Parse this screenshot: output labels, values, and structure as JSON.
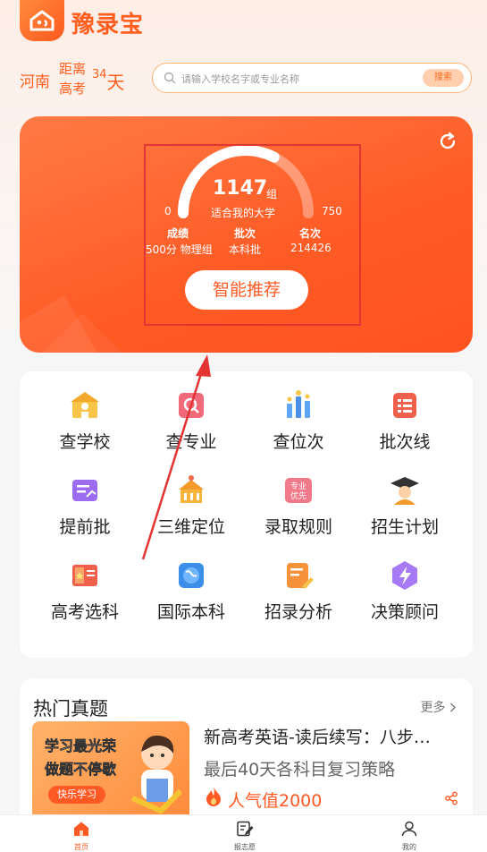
{
  "app": {
    "name": "豫录宝"
  },
  "header": {
    "province": "河南",
    "dist_line1": "距离",
    "dist_line2": "高考",
    "days_num": "34",
    "days_unit": "天"
  },
  "search": {
    "placeholder": "请输入学校名字或专业名称",
    "button": "搜索"
  },
  "recommend": {
    "count": "1147",
    "count_unit": "组",
    "min": "0",
    "max": "750",
    "caption": "适合我的大学",
    "score_label": "成绩",
    "score_value": "500分 物理组",
    "batch_label": "批次",
    "batch_value": "本科批",
    "rank_label": "名次",
    "rank_value": "214426",
    "button": "智能推荐",
    "gauge_fraction": 0.65
  },
  "grid": [
    {
      "label": "查学校",
      "icon": "school-icon"
    },
    {
      "label": "查专业",
      "icon": "major-search-icon"
    },
    {
      "label": "查位次",
      "icon": "rank-chart-icon"
    },
    {
      "label": "批次线",
      "icon": "batch-list-icon"
    },
    {
      "label": "提前批",
      "icon": "early-batch-icon"
    },
    {
      "label": "三维定位",
      "icon": "locate-building-icon"
    },
    {
      "label": "录取规则",
      "icon": "major-priority-icon"
    },
    {
      "label": "招生计划",
      "icon": "graduate-icon"
    },
    {
      "label": "高考选科",
      "icon": "subject-book-icon"
    },
    {
      "label": "国际本科",
      "icon": "globe-icon"
    },
    {
      "label": "招录分析",
      "icon": "analysis-doc-icon"
    },
    {
      "label": "决策顾问",
      "icon": "lightning-icon"
    }
  ],
  "hot": {
    "title": "热门真题",
    "more": "更多",
    "thumb_line1": "学习最光荣",
    "thumb_line2": "做题不停歇",
    "thumb_pill": "快乐学习",
    "article_title": "新高考英语-读后续写：八步…",
    "article_sub": "最后40天各科目复习策略",
    "popularity": "人气值2000"
  },
  "tabs": [
    {
      "label": "首页"
    },
    {
      "label": "报志愿"
    },
    {
      "label": "我的"
    }
  ],
  "colors": {
    "accent": "#ff5a24",
    "annotation": "#e33333"
  }
}
